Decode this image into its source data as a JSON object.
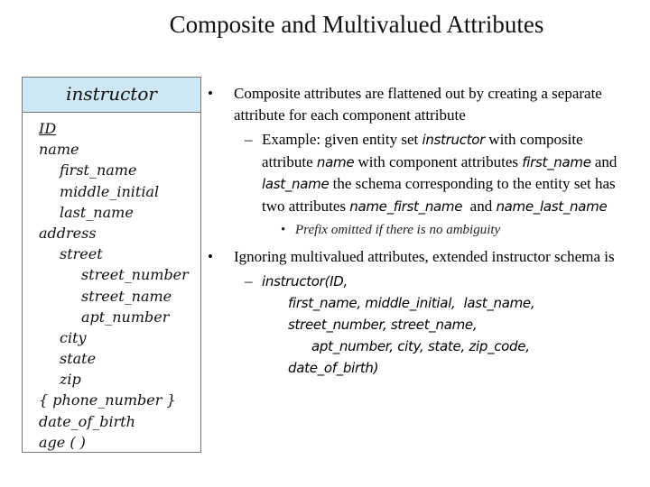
{
  "title": "Composite and Multivalued Attributes",
  "entity": {
    "name": "instructor",
    "header_color": "#cde7f4",
    "attributes": [
      {
        "label": "ID",
        "level": 0,
        "primary_key": true
      },
      {
        "label": "name",
        "level": 0
      },
      {
        "label": "first_name",
        "level": 1
      },
      {
        "label": "middle_initial",
        "level": 1
      },
      {
        "label": "last_name",
        "level": 1
      },
      {
        "label": "address",
        "level": 0
      },
      {
        "label": "street",
        "level": 1
      },
      {
        "label": "street_number",
        "level": 2
      },
      {
        "label": "street_name",
        "level": 2
      },
      {
        "label": "apt_number",
        "level": 2
      },
      {
        "label": "city",
        "level": 1
      },
      {
        "label": "state",
        "level": 1
      },
      {
        "label": "zip",
        "level": 1
      },
      {
        "label": "{ phone_number }",
        "level": 0
      },
      {
        "label": "date_of_birth",
        "level": 0
      },
      {
        "label": "age ( )",
        "level": 0
      }
    ]
  },
  "bullets": {
    "b1": {
      "mark": "•",
      "text": "Composite attributes are flattened out by creating a separate attribute for each component attribute",
      "sub": {
        "mark": "–",
        "parts": [
          "Example: given entity set ",
          "instructor",
          " with composite attribute ",
          "name",
          " with component attributes ",
          "first_name",
          " and ",
          "last_name",
          " the schema corresponding to the entity set has two attributes ",
          "name_first_name",
          "  and ",
          "name_last_name"
        ],
        "sub": {
          "mark": "•",
          "text": "Prefix omitted if there is no ambiguity"
        }
      }
    },
    "b2": {
      "mark": "•",
      "text": "Ignoring multivalued attributes, extended instructor schema is",
      "sub": {
        "mark": "–",
        "schema_lines": [
          "instructor(ID,",
          "first_name, middle_initial,  last_name,",
          "street_number, street_name,",
          "apt_number, city, state, zip_code,",
          "date_of_birth)"
        ]
      }
    }
  }
}
